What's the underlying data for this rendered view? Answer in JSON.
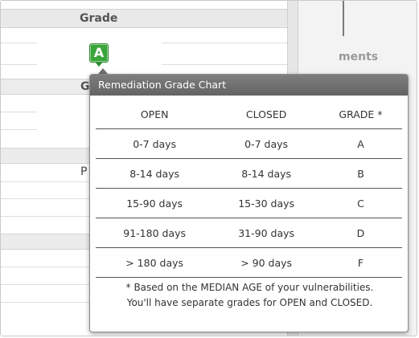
{
  "background": {
    "grade_header": "Grade",
    "grade_badge": "A",
    "partial_band_label": "G",
    "partial_row_letter": "P",
    "right_heading_partial": "ments"
  },
  "popup": {
    "title": "Remediation Grade Chart",
    "columns": [
      "OPEN",
      "CLOSED",
      "GRADE *"
    ],
    "rows": [
      [
        "0-7 days",
        "0-7 days",
        "A"
      ],
      [
        "8-14 days",
        "8-14 days",
        "B"
      ],
      [
        "15-90 days",
        "15-30 days",
        "C"
      ],
      [
        "91-180 days",
        "31-90 days",
        "D"
      ],
      [
        "> 180 days",
        "> 90 days",
        "F"
      ]
    ],
    "footnote_line1": "* Based on the MEDIAN AGE of your vulnerabilities.",
    "footnote_line2": "You'll have separate grades for OPEN and CLOSED."
  },
  "colors": {
    "grade_a_green": "#3aa53a",
    "popup_header": "#6f6f6f"
  }
}
